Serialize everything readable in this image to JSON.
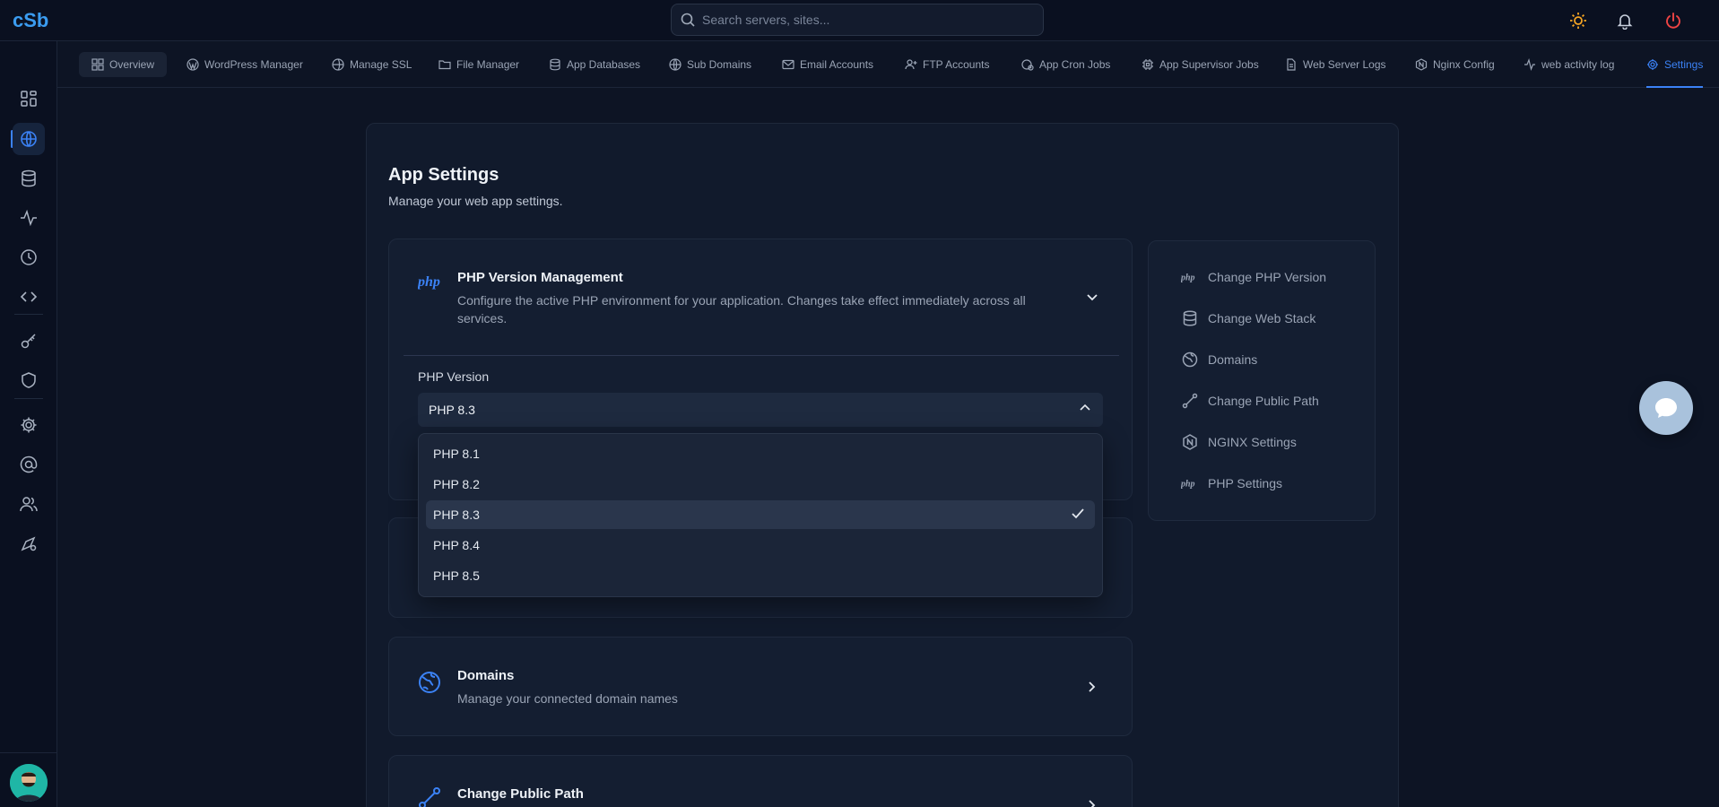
{
  "search": {
    "placeholder": "Search servers, sites..."
  },
  "tabs": [
    {
      "label": "Overview",
      "icon": "grid-icon"
    },
    {
      "label": "WordPress Manager",
      "icon": "wordpress-icon"
    },
    {
      "label": "Manage SSL",
      "icon": "globe-lock-icon"
    },
    {
      "label": "File Manager",
      "icon": "folder-icon"
    },
    {
      "label": "App Databases",
      "icon": "database-icon"
    },
    {
      "label": "Sub Domains",
      "icon": "globe-icon"
    },
    {
      "label": "Email Accounts",
      "icon": "mail-icon"
    },
    {
      "label": "FTP Accounts",
      "icon": "user-plus-icon"
    },
    {
      "label": "App Cron Jobs",
      "icon": "clock-globe-icon"
    },
    {
      "label": "App Supervisor Jobs",
      "icon": "cpu-icon"
    },
    {
      "label": "Web Server Logs",
      "icon": "file-text-icon"
    },
    {
      "label": "Nginx Config",
      "icon": "nginx-icon"
    },
    {
      "label": "web activity log",
      "icon": "activity-icon"
    },
    {
      "label": "Settings",
      "icon": "gear-icon"
    }
  ],
  "page": {
    "title": "App Settings",
    "subtitle": "Manage your web app settings."
  },
  "php_section": {
    "title": "PHP Version Management",
    "description": "Configure the active PHP environment for your application. Changes take effect immediately across all services.",
    "field_label": "PHP Version",
    "selected": "PHP 8.3",
    "options": [
      "PHP 8.1",
      "PHP 8.2",
      "PHP 8.3",
      "PHP 8.4",
      "PHP 8.5"
    ]
  },
  "domains_section": {
    "title": "Domains",
    "description": "Manage your connected domain names"
  },
  "public_path_section": {
    "title": "Change Public Path"
  },
  "quick_nav": [
    {
      "label": "Change PHP Version",
      "icon": "php-icon"
    },
    {
      "label": "Change Web Stack",
      "icon": "database-icon"
    },
    {
      "label": "Domains",
      "icon": "globe-icon"
    },
    {
      "label": "Change Public Path",
      "icon": "path-icon"
    },
    {
      "label": "NGINX Settings",
      "icon": "nginx-icon"
    },
    {
      "label": "PHP Settings",
      "icon": "php-icon"
    }
  ],
  "colors": {
    "accent": "#3b82f6",
    "background": "#0d1424",
    "power": "#ef4444",
    "sun": "#f5a524"
  }
}
